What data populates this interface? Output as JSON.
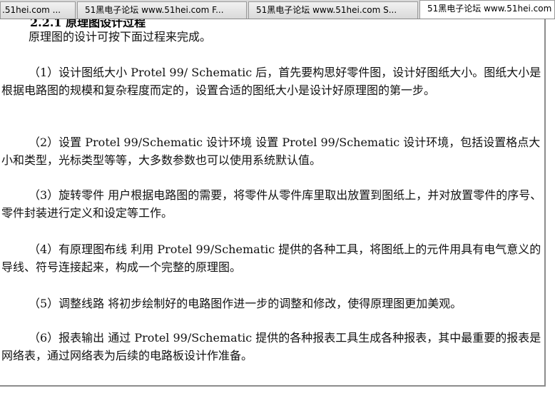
{
  "tabs": [
    {
      "label": ".51hei.com ..."
    },
    {
      "label": "51黑电子论坛 www.51hei.com F..."
    },
    {
      "label": "51黑电子论坛 www.51hei.com S..."
    },
    {
      "label": "51黑电子论坛 www.51hei.com"
    }
  ],
  "document": {
    "cut_heading": "2.2.1 原理图设计过程",
    "intro": "原理图的设计可按下面过程来完成。",
    "paragraphs": [
      "（1）设计图纸大小 Protel 99/ Schematic 后，首先要构思好零件图，设计好图纸大小。图纸大小是根据电路图的规模和复杂程度而定的，设置合适的图纸大小是设计好原理图的第一步。",
      "（2）设置 Protel 99/Schematic 设计环境 设置 Protel 99/Schematic 设计环境，包括设置格点大小和类型，光标类型等等，大多数参数也可以使用系统默认值。",
      "（3）旋转零件 用户根据电路图的需要，将零件从零件库里取出放置到图纸上，并对放置零件的序号、零件封装进行定义和设定等工作。",
      "（4）有原理图布线 利用 Protel 99/Schematic 提供的各种工具，将图纸上的元件用具有电气意义的导线、符号连接起来，构成一个完整的原理图。",
      "（5）调整线路 将初步绘制好的电路图作进一步的调整和修改，使得原理图更加美观。",
      "（6）报表输出 通过 Protel 99/Schematic 提供的各种报表工具生成各种报表，其中最重要的报表是网络表，通过网络表为后续的电路板设计作准备。"
    ]
  }
}
